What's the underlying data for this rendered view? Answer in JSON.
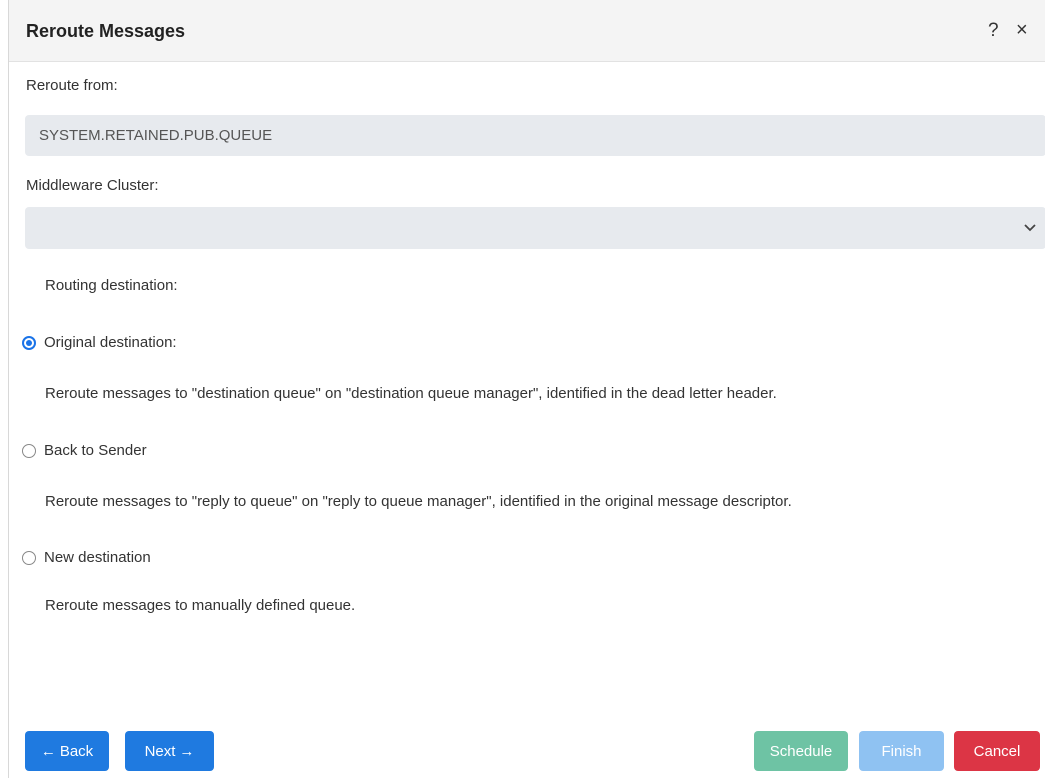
{
  "dialog": {
    "title": "Reroute Messages",
    "help_icon": "?",
    "close_icon": "×"
  },
  "form": {
    "reroute_from_label": "Reroute from:",
    "reroute_from_value": "SYSTEM.RETAINED.PUB.QUEUE",
    "middleware_cluster_label": "Middleware Cluster:",
    "middleware_cluster_value": "",
    "routing_destination_label": "Routing destination:"
  },
  "options": [
    {
      "label": "Original destination:",
      "checked": true,
      "description": "Reroute messages to \"destination queue\" on \"destination queue manager\", identified in the dead letter header."
    },
    {
      "label": "Back to Sender",
      "checked": false,
      "description": "Reroute messages to \"reply to queue\" on \"reply to queue manager\", identified in the original message descriptor."
    },
    {
      "label": "New destination",
      "checked": false,
      "description": "Reroute messages to manually defined queue."
    }
  ],
  "buttons": {
    "back": "Back",
    "back_icon": "←",
    "next": "Next",
    "next_icon": "→",
    "schedule": "Schedule",
    "finish": "Finish",
    "cancel": "Cancel"
  },
  "colors": {
    "primary": "#1f7ae0",
    "schedule": "#6ec3a4",
    "finish_disabled": "#8fc2f2",
    "cancel": "#dc3545",
    "field_bg": "#e7eaee"
  }
}
